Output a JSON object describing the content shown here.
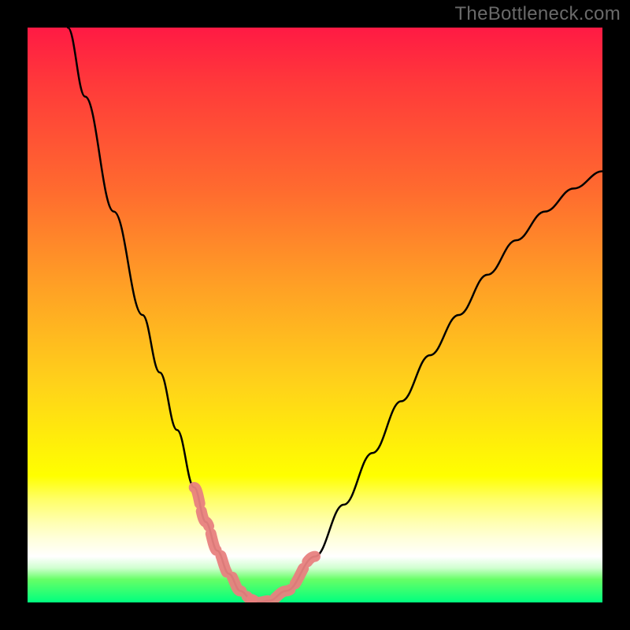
{
  "watermark": "TheBottleneck.com",
  "chart_data": {
    "type": "line",
    "title": "",
    "xlabel": "",
    "ylabel": "",
    "xlim": [
      0,
      100
    ],
    "ylim": [
      0,
      100
    ],
    "grid": false,
    "series": [
      {
        "name": "bottleneck-curve",
        "x_pct": [
          7,
          10,
          15,
          20,
          23,
          26,
          29,
          31,
          33,
          35,
          37,
          39,
          40,
          42,
          45,
          50,
          55,
          60,
          65,
          70,
          75,
          80,
          85,
          90,
          95,
          100
        ],
        "y_pct": [
          100,
          88,
          68,
          50,
          40,
          30,
          20,
          14,
          9,
          5,
          2,
          0.5,
          0,
          0.3,
          2,
          8,
          17,
          26,
          35,
          43,
          50,
          57,
          63,
          68,
          72,
          75
        ]
      }
    ],
    "highlight_segments": {
      "left_index_range": [
        6,
        11
      ],
      "right_index_range": [
        11,
        15
      ]
    },
    "colors": {
      "curve": "#000000",
      "highlight": "#e8817f",
      "gradient_top": "#ff1a44",
      "gradient_bottom": "#00ff7f"
    }
  }
}
